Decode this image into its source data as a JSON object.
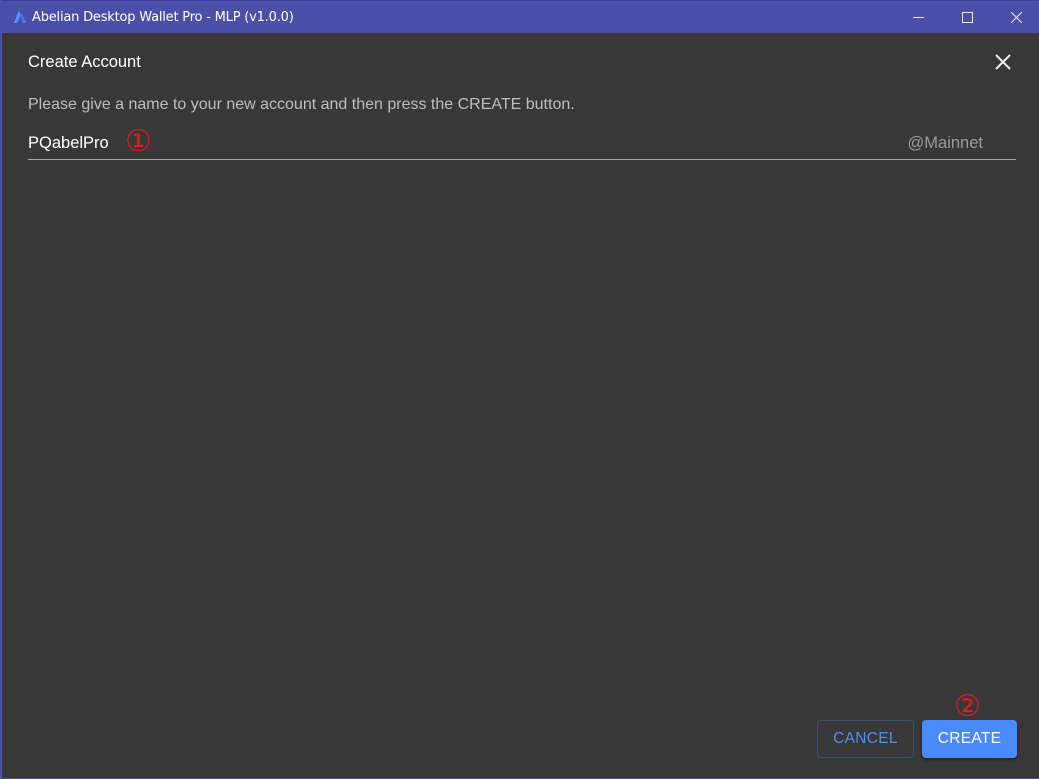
{
  "window": {
    "title": "Abelian Desktop Wallet Pro - MLP (v1.0.0)",
    "app_icon": "abelian-logo-icon",
    "controls": {
      "minimize_icon": "minimize-icon",
      "maximize_icon": "maximize-icon",
      "close_icon": "close-icon"
    },
    "colors": {
      "titlebar": "#4a4fa8",
      "background": "#383838"
    }
  },
  "dialog": {
    "title": "Create Account",
    "close_icon": "close-icon",
    "instructions": "Please give a name to your new account and then press the CREATE button.",
    "name_field": {
      "value": "PQabelPro",
      "placeholder": "",
      "suffix": "@Mainnet"
    },
    "buttons": {
      "cancel_label": "CANCEL",
      "create_label": "CREATE"
    },
    "colors": {
      "primary": "#4a8cff",
      "cancel_text": "#4e8ef0"
    }
  },
  "annotations": {
    "marker_1": "①",
    "marker_2": "②",
    "color": "#e81818"
  }
}
